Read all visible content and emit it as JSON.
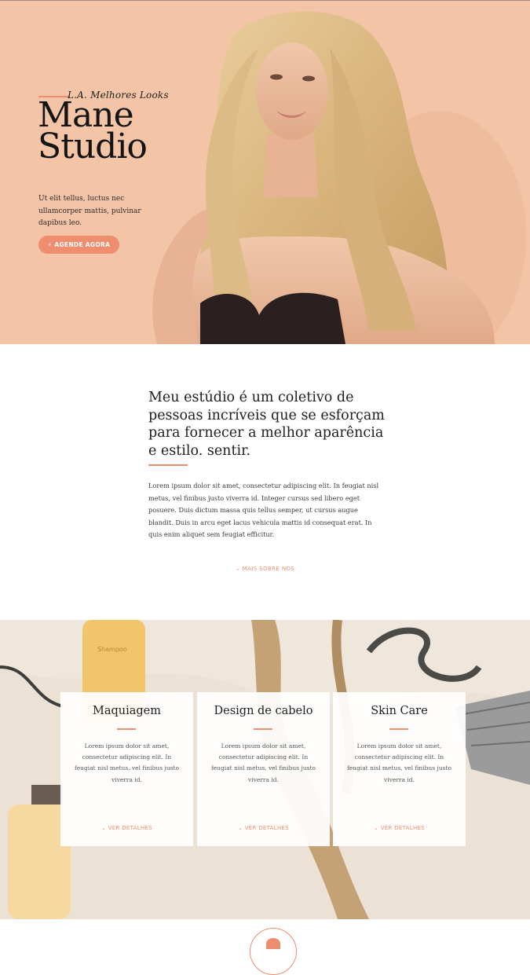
{
  "hero": {
    "tagline": "L.A. Melhores Looks",
    "title_line1": "Mane",
    "title_line2": "Studio",
    "text": "Ut elit tellus, luctus nec ullamcorper mattis, pulvinar dapibus leo.",
    "cta_icon": "bolt-icon",
    "cta_label": "AGENDE AGORA"
  },
  "about": {
    "heading": "Meu estúdio é um coletivo de pessoas incríveis que se esforçam para fornecer a melhor aparência e estilo. sentir.",
    "body": "Lorem ipsum dolor sit amet, consectetur adipiscing elit. In feugiat nisl metus, vel finibus justo viverra id. Integer cursus sed libero eget posuere. Duis dictum massa quis tellus semper, ut cursus augue blandit. Duis in arcu eget lacus vehicula mattis id consequat erat. In quis enim aliquet sem feugiat efficitur.",
    "more_label": "MAIS SOBRE NOS",
    "more_icon": "chevron-down-icon"
  },
  "services": {
    "bottle_label": "Shampoo",
    "cards": [
      {
        "title": "Maquiagem",
        "text": "Lorem ipsum dolor sit amet, consectetur adipiscing elit. In feugiat nisl metus, vel finibus justo viverra id.",
        "link": "VER DETALHES"
      },
      {
        "title": "Design de cabelo",
        "text": "Lorem ipsum dolor sit amet, consectetur adipiscing elit. In feugiat nisl metus, vel finibus justo viverra id.",
        "link": "VER DETALHES"
      },
      {
        "title": "Skin Care",
        "text": "Lorem ipsum dolor sit amet, consectetur adipiscing elit. In feugiat nisl metus, vel finibus justo viverra id.",
        "link": "VER DETALHES"
      }
    ]
  },
  "colors": {
    "accent": "#ef8d6f",
    "hero_bg": "#f4c4a6",
    "text": "#2b2b2b"
  }
}
